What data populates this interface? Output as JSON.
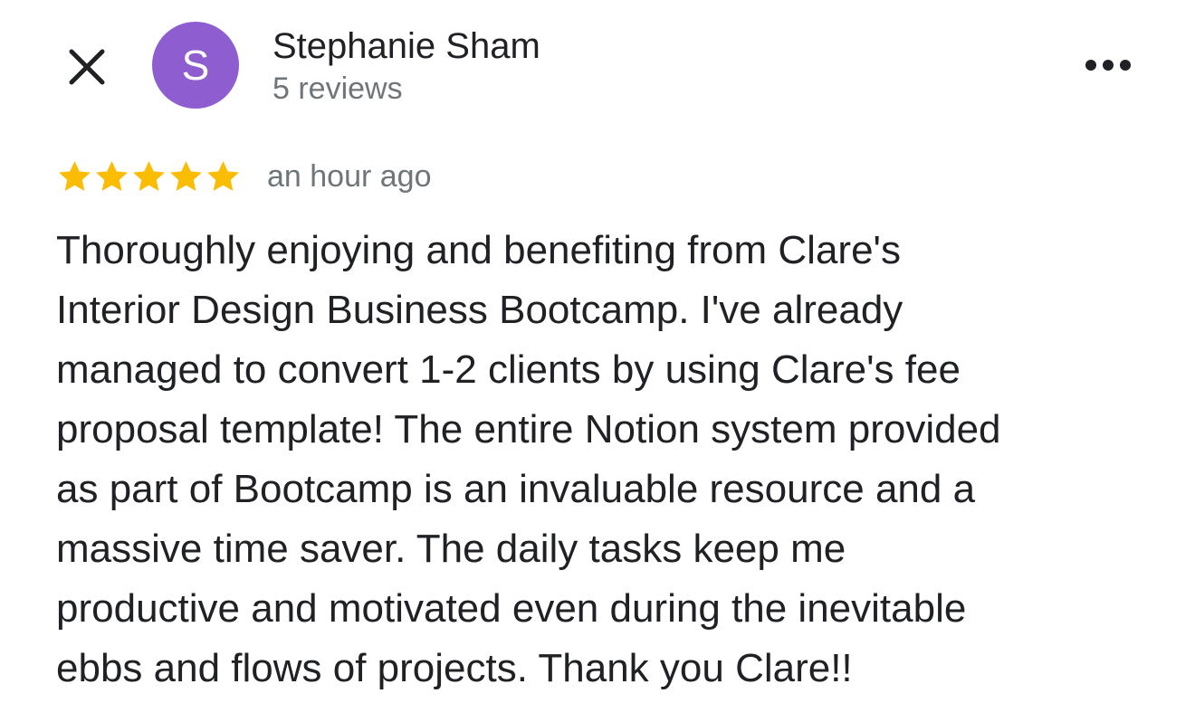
{
  "header": {
    "close_icon": "close-icon",
    "avatar_initial": "S",
    "avatar_color": "#8e5dd0",
    "reviewer_name": "Stephanie Sham",
    "review_count": "5 reviews",
    "more_icon": "more-horizontal-icon"
  },
  "review": {
    "rating": 5,
    "max_rating": 5,
    "star_color": "#fbbc04",
    "time_ago": "an hour ago",
    "text": "Thoroughly enjoying and benefiting from Clare's\nInterior Design Business Bootcamp. I've already\nmanaged to convert 1-2 clients by using Clare's fee\nproposal template! The entire Notion system provided\nas part of Bootcamp is an invaluable resource and a\nmassive time saver. The daily tasks keep me\nproductive and motivated even during the inevitable\nebbs and flows of projects. Thank you Clare!!"
  }
}
